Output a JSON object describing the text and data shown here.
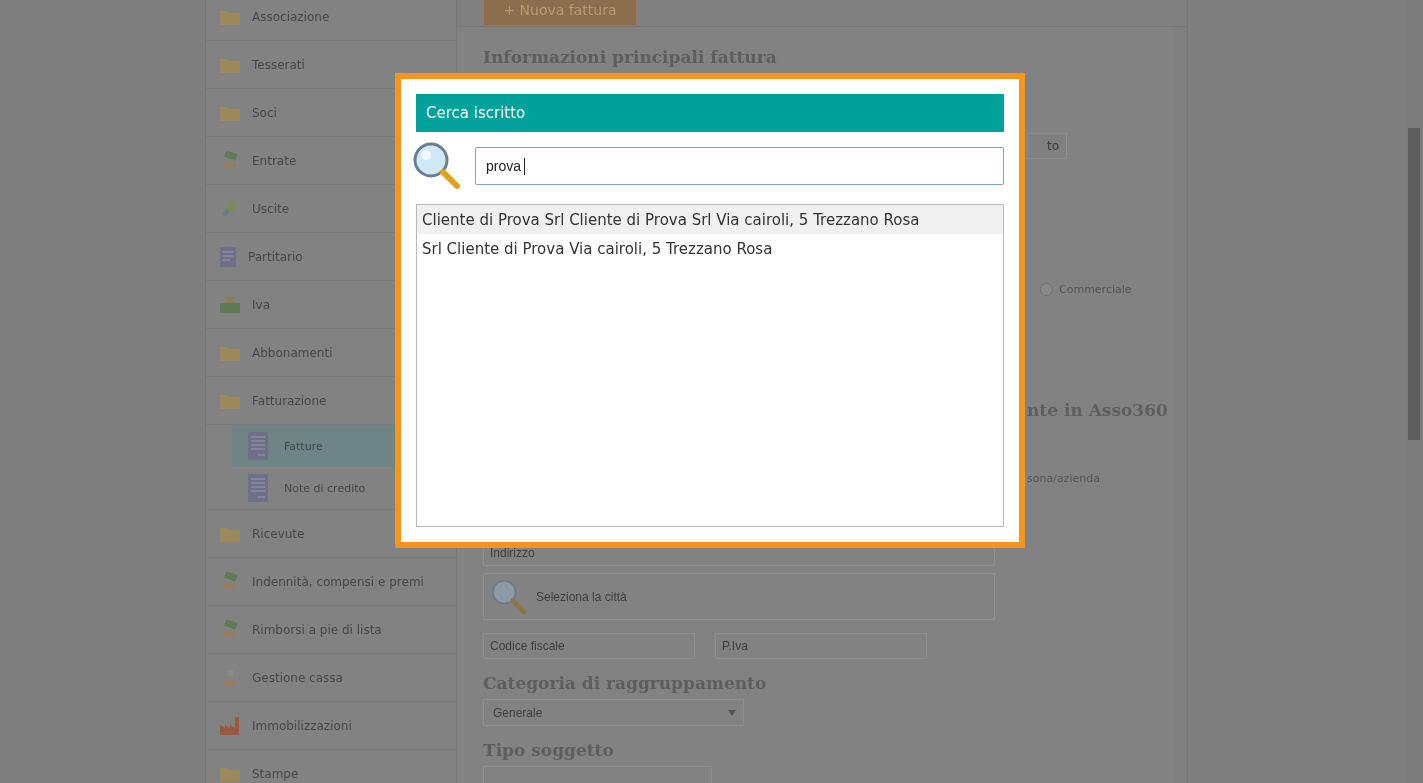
{
  "sidebar": {
    "items": [
      {
        "label": "Associazione",
        "kind": "folder",
        "selected": false
      },
      {
        "label": "Tesserati",
        "kind": "folder",
        "selected": false
      },
      {
        "label": "Soci",
        "kind": "folder",
        "selected": false
      },
      {
        "label": "Entrate",
        "kind": "money-hand",
        "selected": false
      },
      {
        "label": "Uscite",
        "kind": "payment",
        "selected": false
      },
      {
        "label": "Partitario",
        "kind": "document",
        "selected": false
      },
      {
        "label": "Iva",
        "kind": "tax",
        "selected": false
      },
      {
        "label": "Abbonamenti",
        "kind": "folder",
        "selected": false
      },
      {
        "label": "Fatturazione",
        "kind": "folder",
        "selected": false,
        "children": [
          {
            "label": "Fatture",
            "kind": "receipt",
            "selected": true
          },
          {
            "label": "Note di credito",
            "kind": "receipt",
            "selected": false
          }
        ]
      },
      {
        "label": "Ricevute",
        "kind": "folder",
        "selected": false
      },
      {
        "label": "Indennità, compensi e premi",
        "kind": "money-hand",
        "selected": false
      },
      {
        "label": "Rimborsi a pie di lista",
        "kind": "money-hand",
        "selected": false
      },
      {
        "label": "Gestione cassa",
        "kind": "coins",
        "selected": false
      },
      {
        "label": "Immobilizzazioni",
        "kind": "factory",
        "selected": false
      },
      {
        "label": "Stampe",
        "kind": "folder",
        "selected": false
      }
    ]
  },
  "main": {
    "new_button": "+ Nuova fattura",
    "section_title": "Informazioni principali fattura",
    "fragments": {
      "button_tail": "to",
      "radio_label": "Commerciale",
      "radio_checked": false,
      "heading_tail": "nte in Asso360",
      "label_tail": "sona/azienda"
    },
    "form": {
      "address_placeholder": "Indirizzo",
      "city_placeholder": "Seleziona la città",
      "tax_code_placeholder": "Codice fiscale",
      "vat_placeholder": "P.Iva",
      "category_title": "Categoria di raggruppamento",
      "category_value": "Generale",
      "subject_title": "Tipo soggetto"
    }
  },
  "modal": {
    "title": "Cerca iscritto",
    "search_value": "prova",
    "results": [
      {
        "text": "Cliente di Prova Srl Cliente di Prova Srl Via cairoli, 5 Trezzano Rosa",
        "selected": true
      },
      {
        "text": "Srl Cliente di Prova Via cairoli, 5 Trezzano Rosa",
        "selected": false
      }
    ]
  }
}
